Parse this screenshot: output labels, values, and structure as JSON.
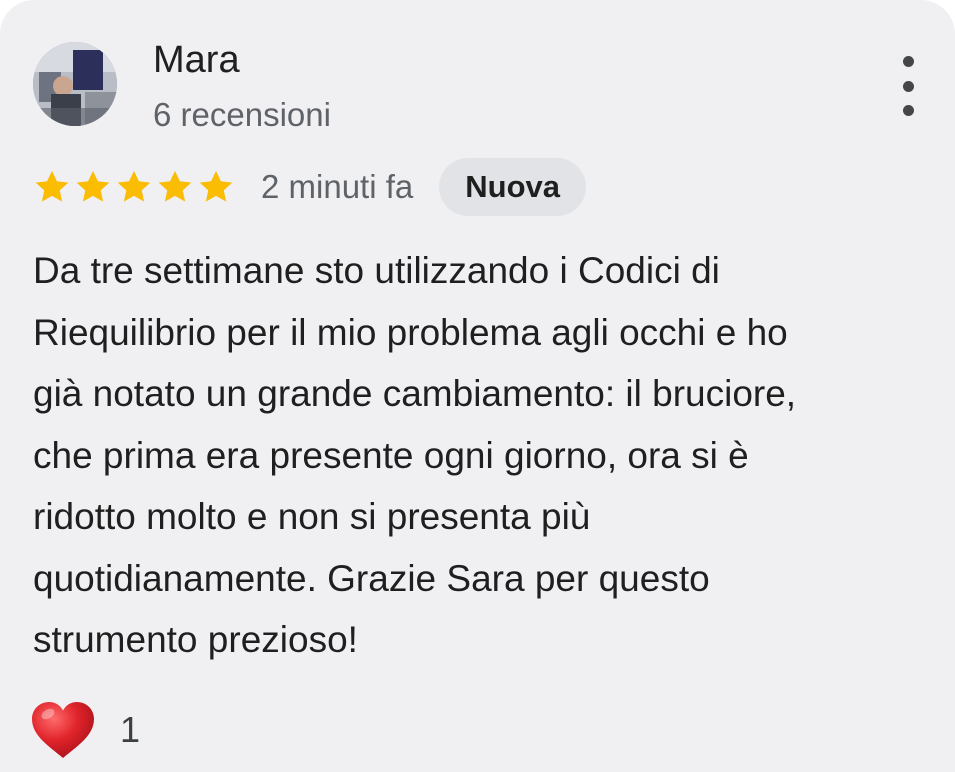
{
  "review": {
    "author_name": "Mara",
    "review_count": "6 recensioni",
    "rating": 5,
    "rating_max": 5,
    "time": "2 minuti fa",
    "badge": "Nuova",
    "text_lines": [
      "Da tre settimane sto utilizzando i Codici di",
      "Riequilibrio per il mio problema agli occhi e ho",
      "già notato un grande cambiamento: il bruciore,",
      "che prima era presente ogni giorno, ora si è",
      "ridotto molto e non si presenta più",
      "quotidianamente. Grazie Sara per questo",
      "strumento prezioso!"
    ],
    "reaction_icon": "heart-icon",
    "reaction_count": "1"
  },
  "colors": {
    "card_background": "#f0f0f3",
    "star": "#fbbc04",
    "badge_background": "#e1e3e6",
    "heart": "#e0242b"
  },
  "icons": {
    "more": "more-vertical-icon",
    "star": "star-icon"
  }
}
